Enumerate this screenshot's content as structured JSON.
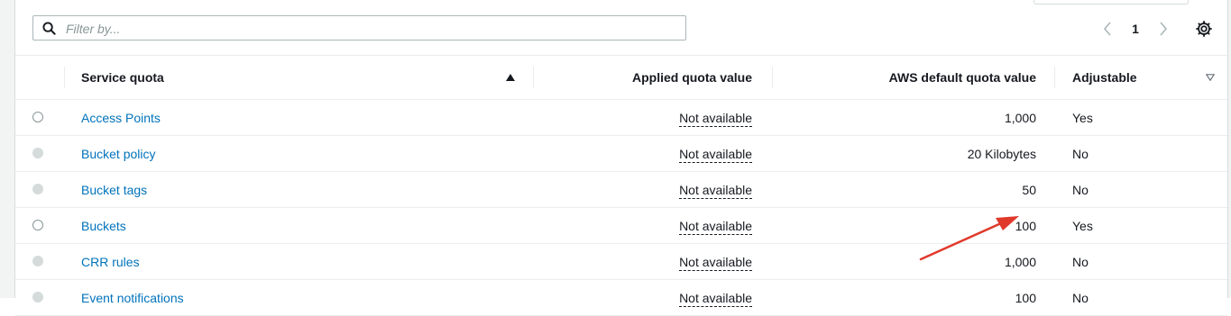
{
  "filter": {
    "placeholder": "Filter by..."
  },
  "pagination": {
    "current_page": "1"
  },
  "table": {
    "columns": {
      "service_quota": "Service quota",
      "applied_quota_value": "Applied quota value",
      "aws_default_quota_value": "AWS default quota value",
      "adjustable": "Adjustable"
    },
    "sort": {
      "column": "Service quota",
      "direction": "ascending"
    },
    "rows": [
      {
        "name": "Access Points",
        "applied": "Not available",
        "default": "1,000",
        "adjustable": "Yes",
        "selectable": true
      },
      {
        "name": "Bucket policy",
        "applied": "Not available",
        "default": "20 Kilobytes",
        "adjustable": "No",
        "selectable": false
      },
      {
        "name": "Bucket tags",
        "applied": "Not available",
        "default": "50",
        "adjustable": "No",
        "selectable": false
      },
      {
        "name": "Buckets",
        "applied": "Not available",
        "default": "100",
        "adjustable": "Yes",
        "selectable": true
      },
      {
        "name": "CRR rules",
        "applied": "Not available",
        "default": "1,000",
        "adjustable": "No",
        "selectable": false
      },
      {
        "name": "Event notifications",
        "applied": "Not available",
        "default": "100",
        "adjustable": "No",
        "selectable": false
      }
    ]
  },
  "annotation": {
    "type": "arrow",
    "color": "#e0392b",
    "points_to": "Buckets AWS default quota value"
  },
  "colors": {
    "link": "#0073bb",
    "border": "#eaeded",
    "text": "#16191f"
  },
  "icons": [
    "search-icon",
    "chevron-left-icon",
    "chevron-right-icon",
    "gear-icon",
    "sort-up-icon",
    "filter-down-icon"
  ]
}
